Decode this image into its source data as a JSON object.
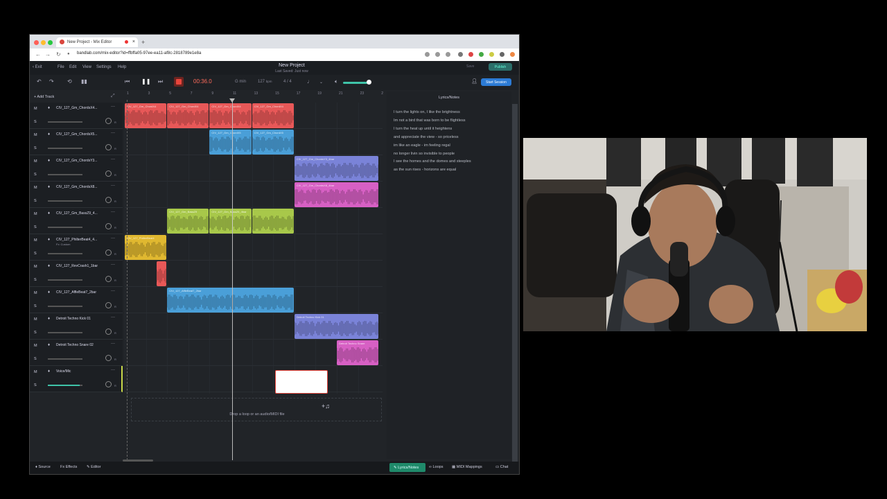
{
  "browser": {
    "tab_title": "New Project - Mix Editor",
    "url": "bandlab.com/mix-editor?id=ffbffa05-97ee-ea11-af8c-2818789e1e8a"
  },
  "menu": {
    "exit": "Exit",
    "file": "File",
    "edit": "Edit",
    "view": "View",
    "settings": "Settings",
    "help": "Help",
    "project_title": "New Project",
    "last_saved": "Last Saved: Just now",
    "save": "Save",
    "publish": "Publish"
  },
  "transport": {
    "time": "00:36.0",
    "key": "G min",
    "tempo": "127",
    "tempo_unit": "bpm",
    "time_signature": "4 / 4",
    "start_session": "Start Session",
    "volume_level": 0.88
  },
  "ruler": [
    "1",
    "3",
    "5",
    "7",
    "9",
    "11",
    "13",
    "15",
    "17",
    "19",
    "21",
    "23",
    "2"
  ],
  "add_track": "+ Add Track",
  "tracks": [
    {
      "name": "CIV_127_Gm_ChordsX4...",
      "sub": "",
      "color": "#e85858"
    },
    {
      "name": "CIV_127_Gm_ChordsX5...",
      "sub": "",
      "color": "#4a9fd8"
    },
    {
      "name": "CIV_127_Gm_ChordsY3...",
      "sub": "",
      "color": "#7a83d8"
    },
    {
      "name": "CIV_127_Gm_ChordsX8...",
      "sub": "",
      "color": "#d760c4"
    },
    {
      "name": "CIV_127_Gm_BassZ9_4...",
      "sub": "",
      "color": "#a8c84a"
    },
    {
      "name": "CIV_127_PhilterBeat4_4...",
      "sub": "Fx: Custom",
      "color": "#e0b830"
    },
    {
      "name": "CIV_127_RevCrash1_1bar",
      "sub": "",
      "color": "#e85858"
    },
    {
      "name": "CIV_127_AffleBeat7_2bar",
      "sub": "",
      "color": "#4a9fd8"
    },
    {
      "name": "Detroit Techno Kick 01",
      "sub": "",
      "color": "#7a83d8"
    },
    {
      "name": "Detroit Techno Snare 02",
      "sub": "",
      "color": "#d760c4"
    },
    {
      "name": "Voice/Mic",
      "sub": "",
      "color": "#3fc3a8"
    }
  ],
  "track_labels": {
    "mute": "M",
    "solo": "S",
    "dots": "···",
    "right": "R"
  },
  "clips": [
    {
      "track": 0,
      "label": "CIV_127_Gm_ChordX4",
      "start": 0,
      "len": 1
    },
    {
      "track": 0,
      "label": "CIV_127_Gm_ChordX4",
      "start": 1,
      "len": 1
    },
    {
      "track": 0,
      "label": "CIV_127_Gm_ChordX4",
      "start": 2,
      "len": 1
    },
    {
      "track": 0,
      "label": "CIV_127_Gm_ChordX4",
      "start": 3,
      "len": 1
    },
    {
      "track": 1,
      "label": "CIV_127_Gm_ChordX5",
      "start": 2,
      "len": 1
    },
    {
      "track": 1,
      "label": "CIV_127_Gm_ChordX5",
      "start": 3,
      "len": 1
    },
    {
      "track": 2,
      "label": "CIV_127_Gm_ChordsY3_4bar",
      "start": 4,
      "len": 2
    },
    {
      "track": 3,
      "label": "CIV_127_Gm_ChordsX8_4bar",
      "start": 4,
      "len": 2
    },
    {
      "track": 4,
      "label": "CIV_127_Gm_BassZ9",
      "start": 1,
      "len": 1
    },
    {
      "track": 4,
      "label": "CIV_127_Gm_BassZ9_4bar",
      "start": 2,
      "len": 1
    },
    {
      "track": 4,
      "label": "",
      "start": 3,
      "len": 1
    },
    {
      "track": 5,
      "label": "CIV_127_PhilterBeat4",
      "start": 0,
      "len": 1
    },
    {
      "track": 6,
      "label": "",
      "start": 0.75,
      "len": 0.25
    },
    {
      "track": 7,
      "label": "CIV_127_AffleBeat7_2bar",
      "start": 1,
      "len": 3
    },
    {
      "track": 8,
      "label": "Detroit Techno Kick 01",
      "start": 4,
      "len": 2
    },
    {
      "track": 9,
      "label": "Detroit Techno Snare",
      "start": 5,
      "len": 1
    }
  ],
  "drop_text": "Drop a loop or an audio/MIDI file",
  "side_panel": {
    "title": "Lyrics/Notes",
    "lyrics": [
      "I turn the lights on, I like the brightness",
      "Im not a bird that was born to be flightless",
      "I turn the heat up until it heightens",
      "and appreciate the view - so priceless",
      "im like an eagle - im feeling regal",
      "no longer livin so invisible to people",
      "I see the homes and the domes and steeples",
      "as the sun rises - horizons are equal"
    ]
  },
  "bottom": {
    "source": "Source",
    "fx": "Fx Effects",
    "editor": "Editor",
    "lyrics_notes": "Lyrics/Notes",
    "loops": "Loops",
    "midi": "MIDI Mappings",
    "chat": "Chat"
  }
}
